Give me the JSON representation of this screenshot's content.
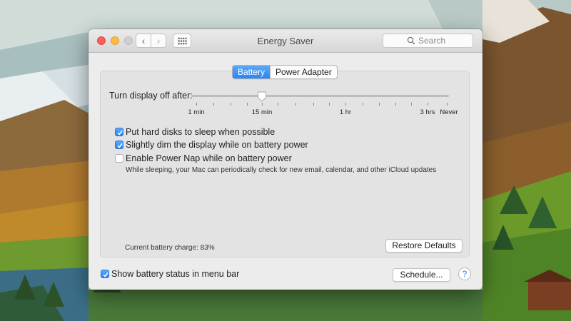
{
  "window": {
    "title": "Energy Saver",
    "nav_back_glyph": "‹",
    "nav_forward_glyph": "›"
  },
  "search": {
    "placeholder": "Search"
  },
  "tabs": [
    {
      "label": "Battery",
      "active": true
    },
    {
      "label": "Power Adapter",
      "active": false
    }
  ],
  "display_sleep": {
    "label": "Turn display off after:",
    "value": "15 min",
    "ticks": [
      "1 min",
      "15 min",
      "1 hr",
      "3 hrs",
      "Never"
    ]
  },
  "options": [
    {
      "label": "Put hard disks to sleep when possible",
      "checked": true
    },
    {
      "label": "Slightly dim the display while on battery power",
      "checked": true
    },
    {
      "label": "Enable Power Nap while on battery power",
      "checked": false
    }
  ],
  "power_nap_note": "While sleeping, your Mac can periodically check for new email, calendar, and other iCloud updates",
  "battery_charge": "Current battery charge: 83%",
  "restore_defaults_label": "Restore Defaults",
  "show_status": {
    "label": "Show battery status in menu bar",
    "checked": true
  },
  "schedule_label": "Schedule...",
  "help_label": "?",
  "colors": {
    "accent": "#2b84ee",
    "close": "#fc605c",
    "minimize": "#fdbc40"
  }
}
